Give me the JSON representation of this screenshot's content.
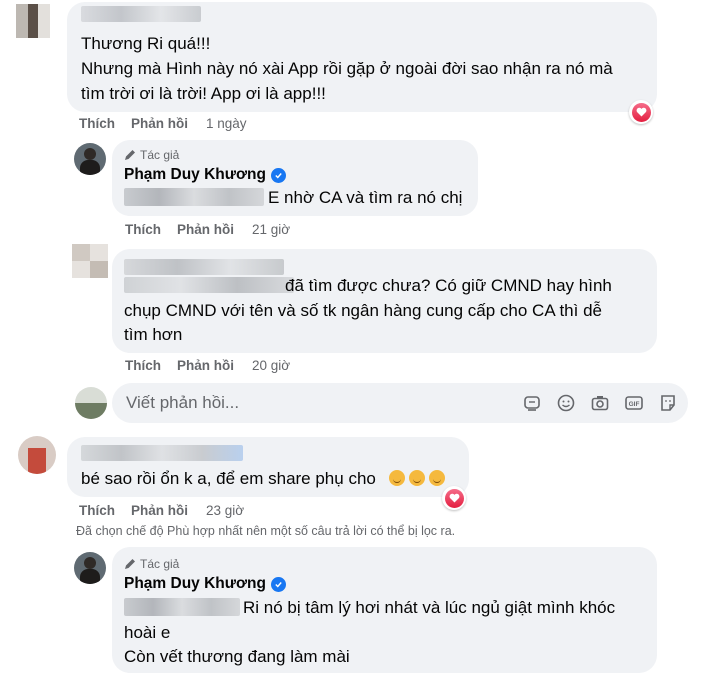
{
  "comments": [
    {
      "lines": [
        "Thương Ri quá!!!",
        "Nhưng mà Hình này nó xài App rồi gặp ở ngoài đời sao nhận ra nó mà",
        "tìm trời ơi là trời! App ơi là app!!!"
      ],
      "actions": {
        "like": "Thích",
        "reply": "Phản hồi",
        "time": "1 ngày"
      },
      "reaction": "heart-icon"
    },
    {
      "author_tag": "Tác giả",
      "author_name": "Phạm Duy Khương",
      "text": "E nhờ CA và tìm ra nó chị",
      "actions": {
        "like": "Thích",
        "reply": "Phản hồi",
        "time": "21 giờ"
      }
    },
    {
      "lines": [
        "đã tìm được chưa? Có giữ CMND hay hình",
        "chụp CMND với tên và số tk ngân hàng cung cấp cho CA thì dễ",
        "tìm hơn"
      ],
      "actions": {
        "like": "Thích",
        "reply": "Phản hồi",
        "time": "20 giờ"
      }
    },
    {
      "text": "bé sao rồi ổn k a, để em share phụ cho",
      "emoji_count": 3,
      "actions": {
        "like": "Thích",
        "reply": "Phản hồi",
        "time": "23 giờ"
      },
      "reaction": "heart-icon"
    },
    {
      "author_tag": "Tác giả",
      "author_name": "Phạm Duy Khương",
      "lines": [
        "Ri nó bị tâm lý hơi nhát và lúc ngủ giật mình khóc",
        "hoài e",
        "Còn vết thương đang làm mài"
      ]
    }
  ],
  "reply_box": {
    "placeholder": "Viết phản hồi...",
    "tools": [
      "sticker-icon",
      "emoji-icon",
      "camera-icon",
      "gif-icon",
      "sticker-face-icon"
    ]
  },
  "filter_notice": "Đã chọn chế độ Phù hợp nhất nên một số câu trả lời có thể bị lọc ra.",
  "colors": {
    "bubble": "#f0f2f5",
    "secondary_text": "#65676b",
    "verified": "#1877f2",
    "heart": "#e41e3f"
  }
}
